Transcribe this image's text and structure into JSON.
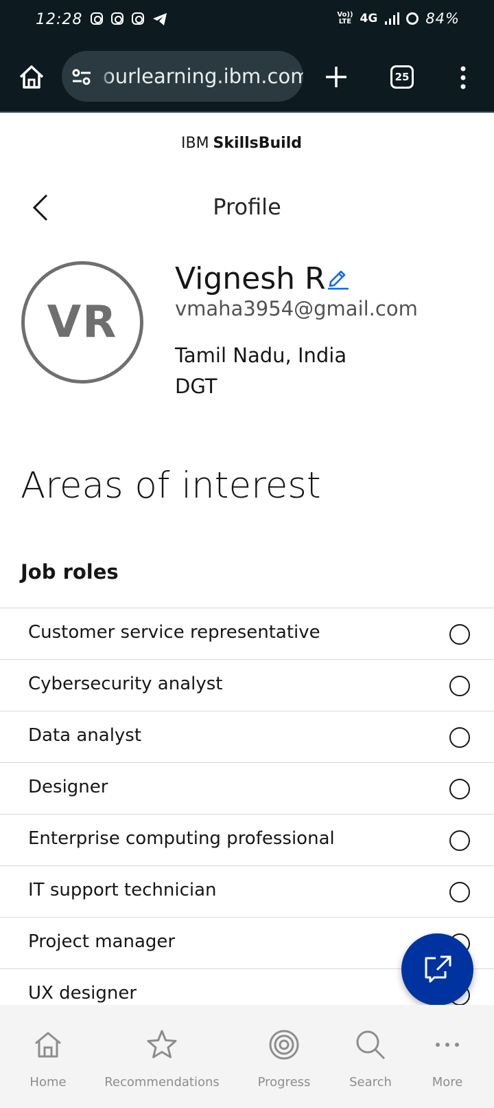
{
  "status_bar": {
    "time": "12:28",
    "network": "4G",
    "volte_top": "Vo))",
    "volte_bottom": "LTE",
    "battery": "84%"
  },
  "browser": {
    "url": "ourlearning.ibm.com",
    "tab_count": "25"
  },
  "header": {
    "brand_ibm": "IBM",
    "brand_product": "SkillsBuild",
    "page_title": "Profile"
  },
  "profile": {
    "initials": "VR",
    "name": "Vignesh R",
    "email": "vmaha3954@gmail.com",
    "location": "Tamil Nadu, India",
    "organization": "DGT"
  },
  "interests": {
    "heading": "Areas of interest",
    "job_roles_heading": "Job roles",
    "job_roles": [
      "Customer service representative",
      "Cybersecurity analyst",
      "Data analyst",
      "Designer",
      "Enterprise computing professional",
      "IT support technician",
      "Project manager",
      "UX designer"
    ]
  },
  "bottom_nav": {
    "items": [
      {
        "label": "Home",
        "icon": "home-icon"
      },
      {
        "label": "Recommendations",
        "icon": "star-icon"
      },
      {
        "label": "Progress",
        "icon": "progress-icon"
      },
      {
        "label": "Search",
        "icon": "search-icon"
      },
      {
        "label": "More",
        "icon": "more-icon"
      }
    ]
  },
  "colors": {
    "fab": "#0033a0",
    "edit_icon": "#0f62fe",
    "status_bar": "#0d1a20"
  }
}
